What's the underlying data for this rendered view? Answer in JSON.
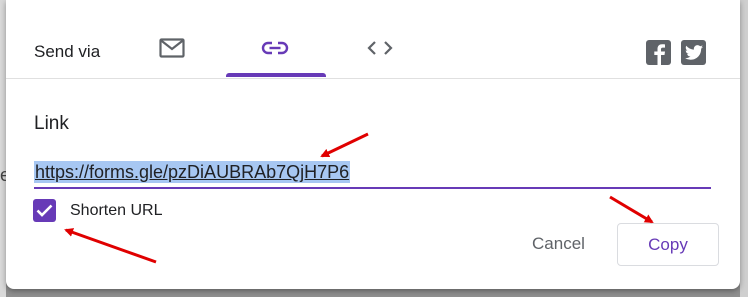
{
  "header": {
    "send_via_label": "Send via",
    "tabs": [
      {
        "icon": "email-icon",
        "active": false
      },
      {
        "icon": "link-icon",
        "active": true
      },
      {
        "icon": "embed-icon",
        "active": false
      }
    ],
    "social": [
      "facebook-icon",
      "twitter-icon"
    ]
  },
  "link_section": {
    "label": "Link",
    "url": "https://forms.gle/pzDiAUBRAb7QjH7P6",
    "shorten_label": "Shorten URL",
    "shorten_checked": true
  },
  "actions": {
    "cancel_label": "Cancel",
    "copy_label": "Copy"
  },
  "annotations": {
    "arrow_color": "#e00000",
    "arrow_count": 3
  },
  "colors": {
    "accent": "#673ab7",
    "selection": "#a7c7f2",
    "icon_gray": "#5f6368"
  }
}
